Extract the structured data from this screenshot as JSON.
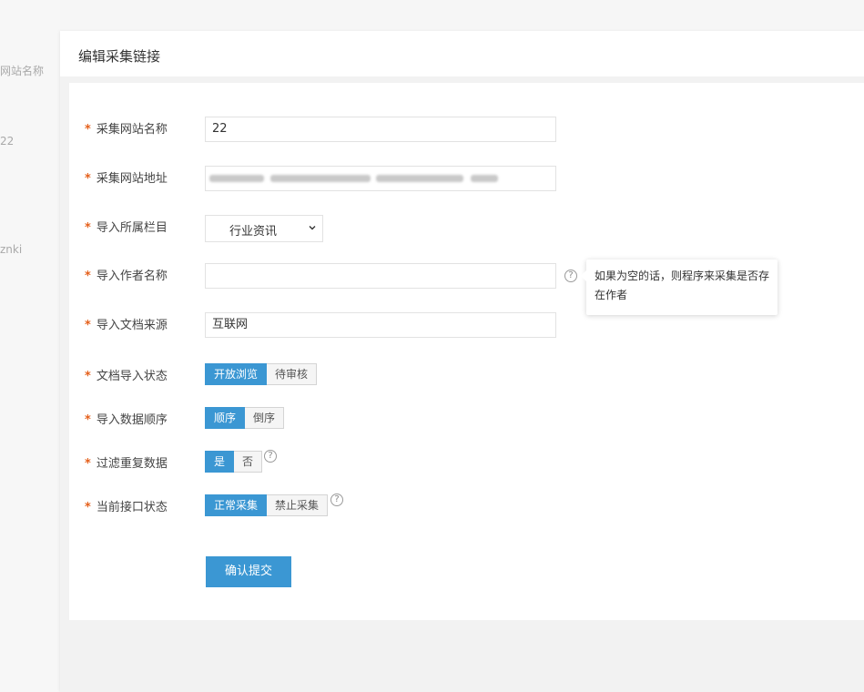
{
  "background": {
    "texts": [
      "网站名称",
      "22",
      "znki"
    ]
  },
  "panel": {
    "title": "编辑采集链接"
  },
  "form": {
    "required_mark": "*",
    "site_name": {
      "label": "采集网站名称",
      "value": "22"
    },
    "site_url": {
      "label": "采集网站地址",
      "value": ""
    },
    "category": {
      "label": "导入所属栏目",
      "selected": "行业资讯"
    },
    "author": {
      "label": "导入作者名称",
      "value": "",
      "help_icon": "?",
      "tooltip": "如果为空的话，则程序来采集是否存在作者"
    },
    "source": {
      "label": "导入文档来源",
      "value": "互联网"
    },
    "doc_status": {
      "label": "文档导入状态",
      "options": [
        "开放浏览",
        "待审核"
      ],
      "active": "开放浏览"
    },
    "order": {
      "label": "导入数据顺序",
      "options": [
        "顺序",
        "倒序"
      ],
      "active": "顺序"
    },
    "dedupe": {
      "label": "过滤重复数据",
      "options": [
        "是",
        "否"
      ],
      "active": "是",
      "help_icon": "?"
    },
    "api_status": {
      "label": "当前接口状态",
      "options": [
        "正常采集",
        "禁止采集"
      ],
      "active": "正常采集",
      "help_icon": "?"
    },
    "submit_label": "确认提交"
  },
  "colors": {
    "accent": "#3b97d3",
    "required": "#e5601b"
  }
}
